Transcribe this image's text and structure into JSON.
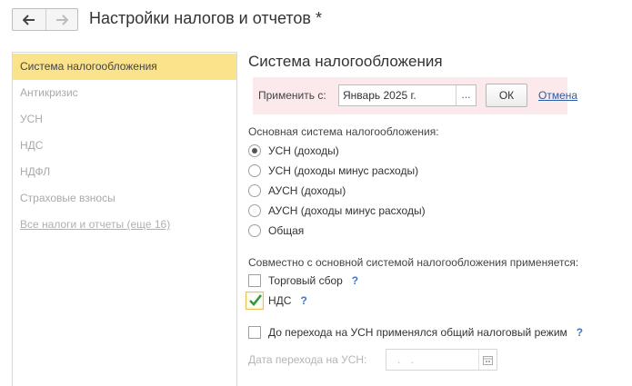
{
  "window": {
    "title": "Настройки налогов и отчетов *"
  },
  "sidebar": {
    "items": [
      {
        "label": "Система налогообложения"
      },
      {
        "label": "Антикризис"
      },
      {
        "label": "УСН"
      },
      {
        "label": "НДС"
      },
      {
        "label": "НДФЛ"
      },
      {
        "label": "Страховые взносы"
      },
      {
        "label": "Все налоги и отчеты (еще 16)"
      }
    ],
    "active_index": 0
  },
  "main": {
    "section_title": "Система налогообложения",
    "apply": {
      "label": "Применить с:",
      "date_value": "Январь 2025 г.",
      "picker_label": "...",
      "ok_label": "ОК",
      "cancel_label": "Отмена"
    },
    "tax_system": {
      "label": "Основная система налогообложения:",
      "options": [
        {
          "label": "УСН (доходы)",
          "selected": true
        },
        {
          "label": "УСН (доходы минус расходы)",
          "selected": false
        },
        {
          "label": "АУСН (доходы)",
          "selected": false
        },
        {
          "label": "АУСН (доходы минус расходы)",
          "selected": false
        },
        {
          "label": "Общая",
          "selected": false
        }
      ]
    },
    "combined": {
      "label": "Совместно с основной системой налогообложения применяется:",
      "items": [
        {
          "label": "Торговый сбор",
          "checked": false,
          "help": "?"
        },
        {
          "label": "НДС",
          "checked": true,
          "help": "?"
        }
      ]
    },
    "prior_regime": {
      "label": "До перехода на УСН применялся общий налоговый режим",
      "checked": false,
      "help": "?"
    },
    "transition_date": {
      "label": "Дата перехода на УСН:",
      "value": ". ."
    }
  },
  "colors": {
    "accent_active": "#fbe38c",
    "apply_panel_bg": "#fbe9ec",
    "link": "#2a5ca8",
    "help": "#3a78c9",
    "check": "#2e9a3a"
  }
}
